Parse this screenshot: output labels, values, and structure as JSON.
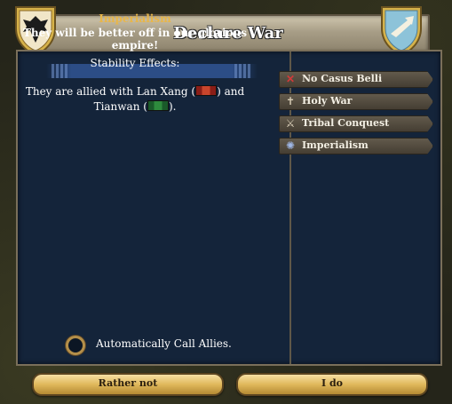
{
  "dialog": {
    "title": "Declare War"
  },
  "left": {
    "cb_title": "Imperialism",
    "cb_description": "They will be better off in our glorious empire!",
    "stability_label": "Stability Effects:",
    "allied_prefix": "They are allied with Lan Xang (",
    "allied_mid": ") and",
    "allied_second_country": "Tianwan (",
    "allied_suffix": ").",
    "allied_countries": [
      "Lan Xang",
      "Tianwan"
    ]
  },
  "casus_belli": [
    {
      "label": "No Casus Belli",
      "icon": "x-icon"
    },
    {
      "label": "Holy War",
      "icon": "cross-icon"
    },
    {
      "label": "Tribal Conquest",
      "icon": "crossed-swords-icon"
    },
    {
      "label": "Imperialism",
      "icon": "globe-icon"
    }
  ],
  "options": {
    "auto_call_allies": "Automatically Call Allies."
  },
  "buttons": {
    "cancel": "Rather not",
    "confirm": "I do"
  },
  "colors": {
    "panel_bg": "#14243a",
    "cb_title": "#e8b64a",
    "button_gold": "#e0b85b"
  }
}
